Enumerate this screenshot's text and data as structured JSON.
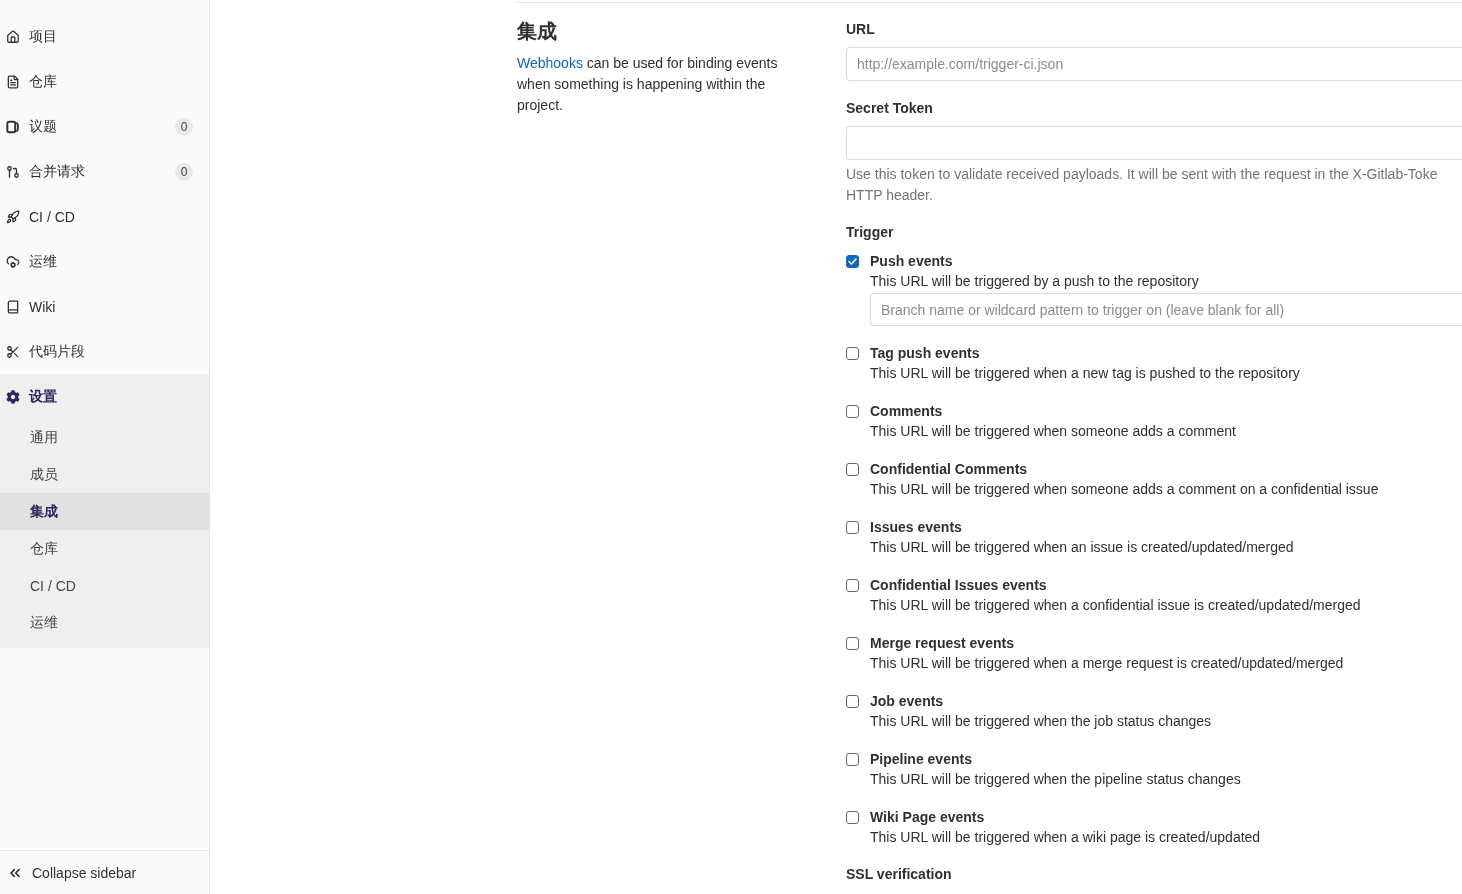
{
  "sidebar": {
    "items": [
      {
        "label": "项目",
        "selected": false
      },
      {
        "label": "仓库",
        "selected": false
      },
      {
        "label": "议题",
        "selected": false,
        "count": "0"
      },
      {
        "label": "合并请求",
        "selected": false,
        "count": "0"
      },
      {
        "label": "CI / CD",
        "selected": false
      },
      {
        "label": "运维",
        "selected": false
      },
      {
        "label": "Wiki",
        "selected": false
      },
      {
        "label": "代码片段",
        "selected": false
      },
      {
        "label": "设置",
        "selected": true,
        "children": [
          {
            "label": "通用",
            "selected": false
          },
          {
            "label": "成员",
            "selected": false
          },
          {
            "label": "集成",
            "selected": true
          },
          {
            "label": "仓库",
            "selected": false
          },
          {
            "label": "CI / CD",
            "selected": false
          },
          {
            "label": "运维",
            "selected": false
          }
        ]
      }
    ],
    "collapse_button": "Collapse sidebar"
  },
  "section": {
    "title": "集成",
    "description": {
      "link": "Webhooks",
      "text": "can be used for binding events when something is happening within the project."
    }
  },
  "form": {
    "fields": [
      {
        "label": "URL",
        "placeholder": "http://example.com/trigger-ci.json"
      },
      {
        "label": "Secret Token",
        "help_lines": [
          "Use this token to validate received payloads. It will be sent with the request in the X-Gitlab-Toke",
          "HTTP header."
        ]
      }
    ],
    "trigger_heading": "Trigger",
    "triggers": [
      {
        "label": "Push events",
        "description": "This URL will be triggered by a push to the repository",
        "checked": true,
        "branch_field": {
          "placeholder": "Branch name or wildcard pattern to trigger on (leave blank for all)"
        }
      },
      {
        "label": "Tag push events",
        "description": "This URL will be triggered when a new tag is pushed to the repository",
        "checked": false
      },
      {
        "label": "Comments",
        "description": "This URL will be triggered when someone adds a comment",
        "checked": false
      },
      {
        "label": "Confidential Comments",
        "description": "This URL will be triggered when someone adds a comment on a confidential issue",
        "checked": false
      },
      {
        "label": "Issues events",
        "description": "This URL will be triggered when an issue is created/updated/merged",
        "checked": false
      },
      {
        "label": "Confidential Issues events",
        "description": "This URL will be triggered when a confidential issue is created/updated/merged",
        "checked": false
      },
      {
        "label": "Merge request events",
        "description": "This URL will be triggered when a merge request is created/updated/merged",
        "checked": false
      },
      {
        "label": "Job events",
        "description": "This URL will be triggered when the job status changes",
        "checked": false
      },
      {
        "label": "Pipeline events",
        "description": "This URL will be triggered when the pipeline status changes",
        "checked": false
      },
      {
        "label": "Wiki Page events",
        "description": "This URL will be triggered when a wiki page is created/updated",
        "checked": false
      }
    ],
    "ssl_heading": "SSL verification"
  }
}
